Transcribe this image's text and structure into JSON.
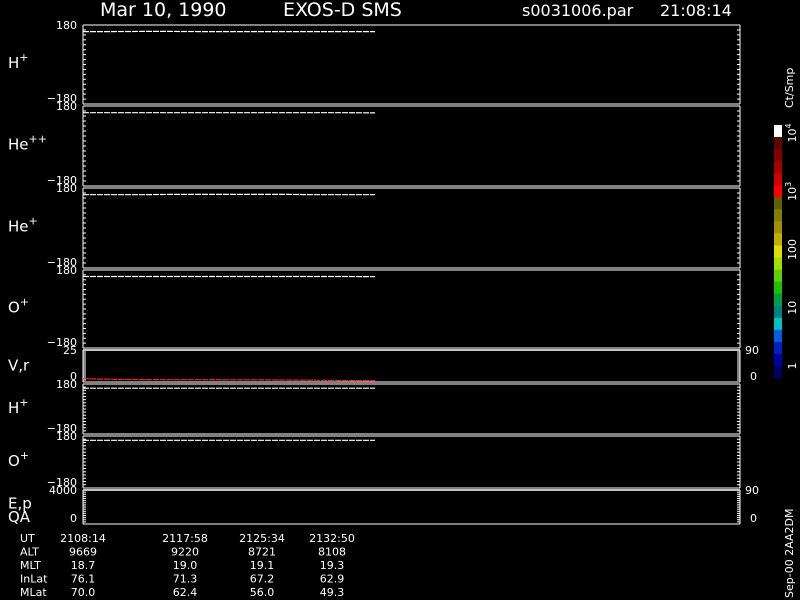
{
  "header": {
    "date": "Mar 10, 1990",
    "mission": "EXOS-D SMS",
    "file": "s0031006.par",
    "time": "21:08:14"
  },
  "colorbar": {
    "unit": "Ct/Smp",
    "tick_labels": [
      "1",
      "10",
      "100",
      "10",
      "10"
    ],
    "tick_exponents": [
      "",
      "",
      "",
      "3",
      "4"
    ],
    "colors": [
      "#000060",
      "#0000a0",
      "#0020c0",
      "#0060e0",
      "#00c0c0",
      "#008080",
      "#00a040",
      "#20c000",
      "#60d000",
      "#a0e000",
      "#e0e000",
      "#c0b000",
      "#a09000",
      "#808000",
      "#606000",
      "#ff0000",
      "#d00000",
      "#a00000",
      "#800000",
      "#600000",
      "#ffffff"
    ]
  },
  "footer_stamp": "Sep-00  2AA2DM",
  "chart_data": {
    "type": "line",
    "time_axis": {
      "start": "21:08:14",
      "end": "21:40:00"
    },
    "panels": [
      {
        "label": "H",
        "superscript": "+",
        "y_top": "180",
        "y_bottom": "−180",
        "y": [
          150,
          150,
          151,
          151,
          150,
          150,
          150,
          150,
          150,
          150,
          150
        ],
        "color": "#ffffff"
      },
      {
        "label": "He",
        "superscript": "++",
        "y_top": "180",
        "y_bottom": "−180",
        "y": [
          150,
          150,
          150,
          150,
          150,
          150,
          150,
          150,
          150,
          150,
          149
        ],
        "color": "#ffffff"
      },
      {
        "label": "He",
        "superscript": "+",
        "y_top": "180",
        "y_bottom": "−180",
        "y": [
          150,
          150,
          150,
          151,
          151,
          151,
          151,
          151,
          150,
          150,
          150
        ],
        "color": "#ffffff"
      },
      {
        "label": "O",
        "superscript": "+",
        "y_top": "180",
        "y_bottom": "−180",
        "y": [
          150,
          150,
          150,
          150,
          150,
          150,
          150,
          150,
          150,
          150,
          149
        ],
        "color": "#ffffff"
      },
      {
        "label": "V,r",
        "superscript": "",
        "y_top": "25",
        "y_bottom": "0",
        "right_top": "90",
        "right_bottom": "0",
        "y": [
          2.6,
          2.1,
          1.9,
          1.8,
          1.8,
          1.7,
          1.7,
          1.5,
          1.3,
          1.2,
          1.0
        ],
        "color": "#ff2020",
        "ref": 25
      },
      {
        "label": "H",
        "superscript": "+",
        "y_top": "180",
        "y_bottom": "−180",
        "y": [
          150,
          150,
          150,
          150,
          150,
          150,
          150,
          150,
          150,
          150,
          150
        ],
        "color": "#ffffff"
      },
      {
        "label": "O",
        "superscript": "+",
        "y_top": "180",
        "y_bottom": "−180",
        "y": [
          150,
          150,
          150,
          150,
          150,
          150,
          150,
          150,
          150,
          150,
          150
        ],
        "color": "#ffffff"
      },
      {
        "label": "E,p",
        "label2": "QA",
        "superscript": "",
        "y_top": "4000",
        "y_bottom": "0",
        "right_top": "90",
        "right_bottom": "0",
        "y": [],
        "color": "#ffffff",
        "ref": 4000
      }
    ]
  },
  "orbit_table": {
    "rows": [
      {
        "name": "UT",
        "values": [
          "2108:14",
          "2117:58",
          "2125:34",
          "2132:50"
        ]
      },
      {
        "name": "ALT",
        "values": [
          "9669",
          "9220",
          "8721",
          "8108"
        ]
      },
      {
        "name": "MLT",
        "values": [
          "18.7",
          "19.0",
          "19.1",
          "19.3"
        ]
      },
      {
        "name": "InLat",
        "values": [
          "76.1",
          "71.3",
          "67.2",
          "62.9"
        ]
      },
      {
        "name": "MLat",
        "values": [
          "70.0",
          "62.4",
          "56.0",
          "49.3"
        ]
      }
    ]
  }
}
